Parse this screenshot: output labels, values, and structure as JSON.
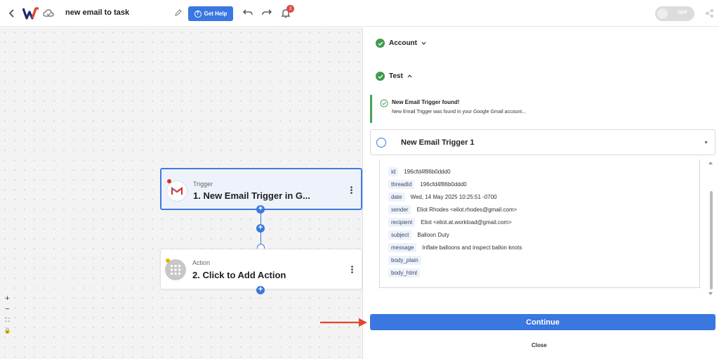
{
  "header": {
    "workflow_title": "new email to task",
    "help_label": "Get Help",
    "notification_count": "3",
    "toggle_label": "OFF"
  },
  "canvas": {
    "trigger_card": {
      "type": "Trigger",
      "title": "1. New Email Trigger in G..."
    },
    "action_card": {
      "type": "Action",
      "title": "2. Click to Add Action"
    },
    "zoom_controls": [
      "+",
      "−",
      "⛶",
      "🔒"
    ]
  },
  "panel": {
    "account_label": "Account",
    "test_label": "Test",
    "success_title": "New Email Trigger found!",
    "success_message": "New Email Trigger was found in your Google Gmail account...",
    "trigger_item_label": "New Email Trigger 1",
    "fields": [
      {
        "key": "id",
        "value": "196cfd4f86b0ddd0"
      },
      {
        "key": "threadId",
        "value": "196cfd4f86b0ddd0"
      },
      {
        "key": "date",
        "value": "Wed, 14 May 2025 10:25:51 -0700"
      },
      {
        "key": "sender",
        "value": "Eliot Rhodes <eliot.rhodes@gmail.com>"
      },
      {
        "key": "recipient",
        "value": "Eliot <eliot.at.workload@gmail.com>"
      },
      {
        "key": "subject",
        "value": "Balloon Duty"
      },
      {
        "key": "message",
        "value": "Inflate balloons and inspect ballon knots"
      },
      {
        "key": "body_plain",
        "value": ""
      },
      {
        "key": "body_html",
        "value": ""
      }
    ],
    "continue_label": "Continue",
    "close_label": "Close"
  },
  "colors": {
    "primary": "#3a77e0",
    "success": "#3f9b4e",
    "arrow": "#e0462b"
  }
}
